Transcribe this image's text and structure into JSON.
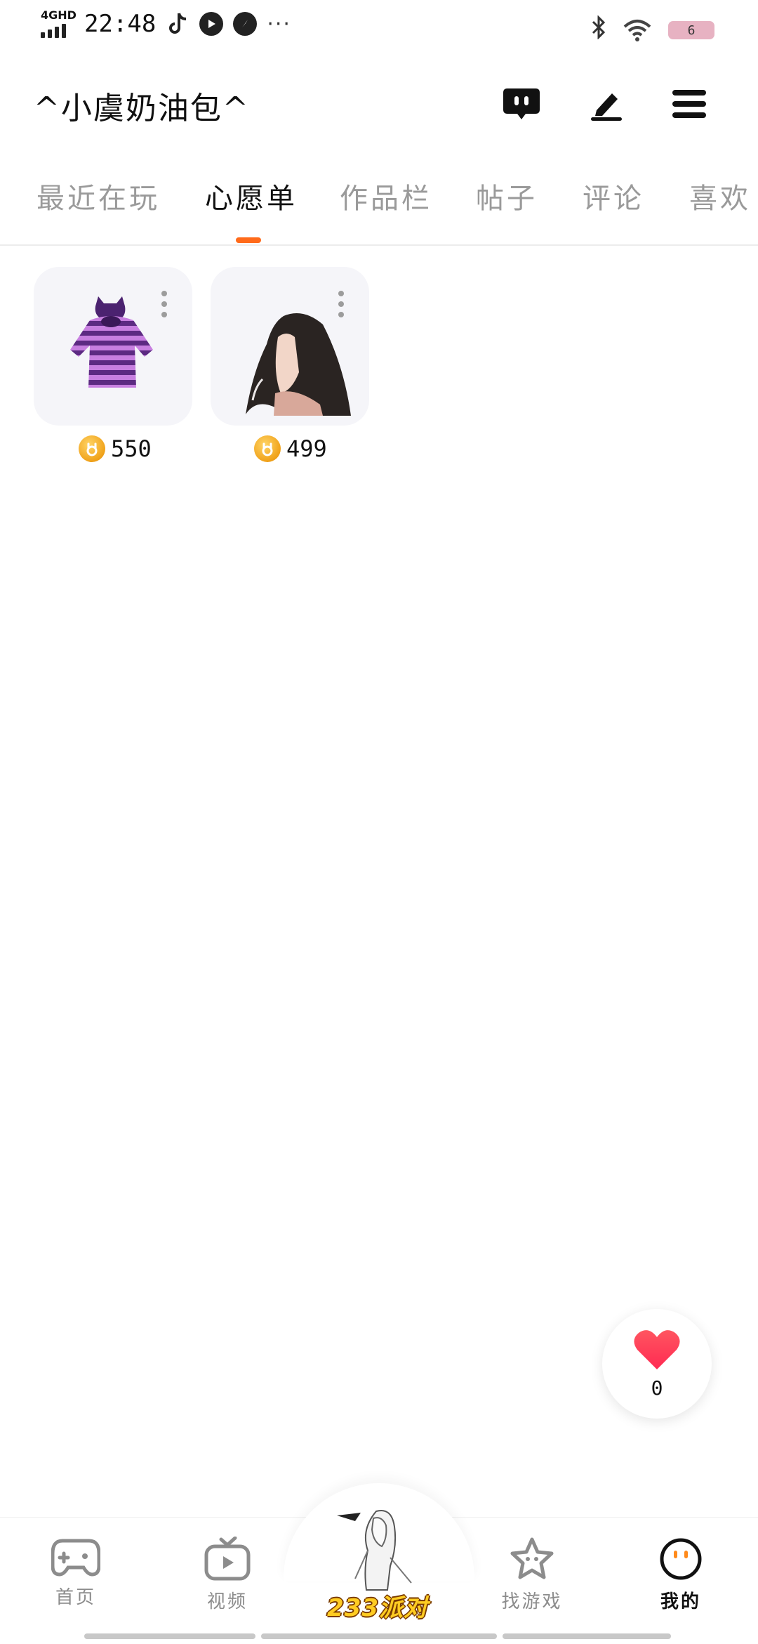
{
  "status_bar": {
    "network": "4GHD",
    "time": "22:48",
    "more": "···",
    "battery": "6"
  },
  "header": {
    "profile_name": "^小虞奶油包^",
    "icons": [
      "message-icon",
      "edit-icon",
      "menu-icon"
    ]
  },
  "tabs": [
    {
      "label": "最近在玩",
      "active": false
    },
    {
      "label": "心愿单",
      "active": true
    },
    {
      "label": "作品栏",
      "active": false
    },
    {
      "label": "帖子",
      "active": false
    },
    {
      "label": "评论",
      "active": false
    },
    {
      "label": "喜欢",
      "active": false
    }
  ],
  "wishlist": [
    {
      "item": "striped hoodie",
      "price": "550"
    },
    {
      "item": "long hair",
      "price": "499"
    }
  ],
  "like": {
    "count": "0"
  },
  "bottom_nav": [
    {
      "label": "首页",
      "icon": "gamepad-icon",
      "active": false
    },
    {
      "label": "视频",
      "icon": "tv-play-icon",
      "active": false
    },
    {
      "label": "233派对",
      "icon": "party-character-icon",
      "active": false
    },
    {
      "label": "找游戏",
      "icon": "star-icon",
      "active": false
    },
    {
      "label": "我的",
      "icon": "face-icon",
      "active": true
    }
  ],
  "colors": {
    "accent": "#ff6a1a",
    "tab_inactive": "#9a9a9a",
    "card_bg": "#f5f5f9",
    "heart": "#ff3b4c"
  }
}
